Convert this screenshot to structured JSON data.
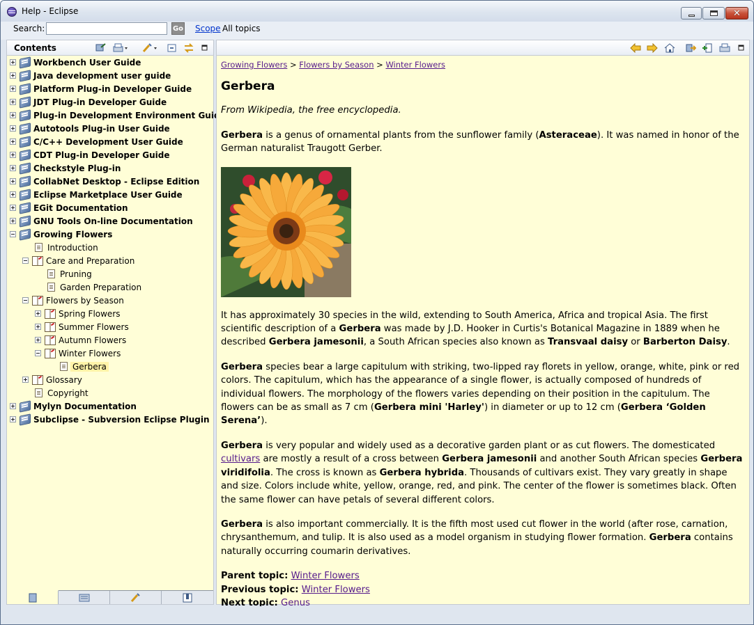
{
  "window": {
    "title": "Help - Eclipse"
  },
  "search": {
    "label": "Search:",
    "value": "",
    "go_label": "Go",
    "scope_link": "Scope",
    "scope_value": "All topics"
  },
  "contents": {
    "title": "Contents"
  },
  "tree": [
    {
      "label": "Workbench User Guide",
      "level": 0,
      "type": "book",
      "expander": "plus",
      "bold": true
    },
    {
      "label": "Java development user guide",
      "level": 0,
      "type": "book",
      "expander": "plus",
      "bold": true
    },
    {
      "label": "Platform Plug-in Developer Guide",
      "level": 0,
      "type": "book",
      "expander": "plus",
      "bold": true
    },
    {
      "label": "JDT Plug-in Developer Guide",
      "level": 0,
      "type": "book",
      "expander": "plus",
      "bold": true
    },
    {
      "label": "Plug-in Development Environment Guide",
      "level": 0,
      "type": "book",
      "expander": "plus",
      "bold": true
    },
    {
      "label": "Autotools Plug-in User Guide",
      "level": 0,
      "type": "book",
      "expander": "plus",
      "bold": true
    },
    {
      "label": "C/C++ Development User Guide",
      "level": 0,
      "type": "book",
      "expander": "plus",
      "bold": true
    },
    {
      "label": "CDT Plug-in Developer Guide",
      "level": 0,
      "type": "book",
      "expander": "plus",
      "bold": true
    },
    {
      "label": "Checkstyle Plug-in",
      "level": 0,
      "type": "book",
      "expander": "plus",
      "bold": true
    },
    {
      "label": "CollabNet Desktop - Eclipse Edition",
      "level": 0,
      "type": "book",
      "expander": "plus",
      "bold": true
    },
    {
      "label": "Eclipse Marketplace User Guide",
      "level": 0,
      "type": "book",
      "expander": "plus",
      "bold": true
    },
    {
      "label": "EGit Documentation",
      "level": 0,
      "type": "book",
      "expander": "plus",
      "bold": true
    },
    {
      "label": "GNU Tools On-line Documentation",
      "level": 0,
      "type": "book",
      "expander": "plus",
      "bold": true
    },
    {
      "label": "Growing Flowers",
      "level": 0,
      "type": "book",
      "expander": "minus",
      "bold": true
    },
    {
      "label": "Introduction",
      "level": 1,
      "type": "page",
      "expander": "none",
      "bold": false
    },
    {
      "label": "Care and Preparation",
      "level": 1,
      "type": "openbook",
      "expander": "minus",
      "bold": false
    },
    {
      "label": "Pruning",
      "level": 2,
      "type": "page",
      "expander": "none",
      "bold": false
    },
    {
      "label": "Garden Preparation",
      "level": 2,
      "type": "page",
      "expander": "none",
      "bold": false
    },
    {
      "label": "Flowers by Season",
      "level": 1,
      "type": "openbook",
      "expander": "minus",
      "bold": false
    },
    {
      "label": "Spring Flowers",
      "level": 2,
      "type": "openbook",
      "expander": "plus",
      "bold": false
    },
    {
      "label": "Summer Flowers",
      "level": 2,
      "type": "openbook",
      "expander": "plus",
      "bold": false
    },
    {
      "label": "Autumn Flowers",
      "level": 2,
      "type": "openbook",
      "expander": "plus",
      "bold": false
    },
    {
      "label": "Winter Flowers",
      "level": 2,
      "type": "openbook",
      "expander": "minus",
      "bold": false
    },
    {
      "label": "Gerbera",
      "level": 3,
      "type": "page",
      "expander": "none",
      "bold": false,
      "selected": true
    },
    {
      "label": "Glossary",
      "level": 1,
      "type": "openbook",
      "expander": "plus",
      "bold": false
    },
    {
      "label": "Copyright",
      "level": 1,
      "type": "page",
      "expander": "none",
      "bold": false
    },
    {
      "label": "Mylyn Documentation",
      "level": 0,
      "type": "book",
      "expander": "plus",
      "bold": true
    },
    {
      "label": "Subclipse - Subversion Eclipse Plugin",
      "level": 0,
      "type": "book",
      "expander": "plus",
      "bold": true
    }
  ],
  "breadcrumb": [
    "Growing Flowers",
    "Flowers by Season",
    "Winter Flowers"
  ],
  "breadcrumb_sep": ">",
  "article": {
    "title": "Gerbera",
    "source": "From Wikipedia, the free encyclopedia.",
    "p1": [
      {
        "t": "Gerbera",
        "b": true
      },
      {
        "t": " is a genus of ornamental plants from the sunflower family ("
      },
      {
        "t": "Asteraceae",
        "b": true
      },
      {
        "t": "). It was named in honor of the German naturalist Traugott Gerber."
      }
    ],
    "p2": [
      {
        "t": "It has approximately 30 species in the wild, extending to South America, Africa and tropical Asia. The first scientific description of a "
      },
      {
        "t": "Gerbera",
        "b": true
      },
      {
        "t": " was made by J.D. Hooker in Curtis's Botanical Magazine in 1889 when he described "
      },
      {
        "t": "Gerbera jamesonii",
        "b": true
      },
      {
        "t": ", a South African species also known as "
      },
      {
        "t": "Transvaal daisy",
        "b": true
      },
      {
        "t": " or "
      },
      {
        "t": "Barberton Daisy",
        "b": true
      },
      {
        "t": "."
      }
    ],
    "p3": [
      {
        "t": "Gerbera",
        "b": true
      },
      {
        "t": " species bear a large capitulum with striking, two-lipped ray florets in yellow, orange, white, pink or red colors. The capitulum, which has the appearance of a single flower, is actually composed of hundreds of individual flowers. The morphology of the flowers varies depending on their position in the capitulum. The flowers can be as small as 7 cm ("
      },
      {
        "t": "Gerbera mini 'Harley'",
        "b": true
      },
      {
        "t": ") in diameter or up to 12 cm ("
      },
      {
        "t": "Gerbera ‘Golden Serena’",
        "b": true
      },
      {
        "t": ")."
      }
    ],
    "p4": [
      {
        "t": "Gerbera",
        "b": true
      },
      {
        "t": " is very popular and widely used as a decorative garden plant or as cut flowers. The domesticated "
      },
      {
        "t": "cultivars",
        "link": true
      },
      {
        "t": " are mostly a result of a cross between "
      },
      {
        "t": "Gerbera jamesonii",
        "b": true
      },
      {
        "t": " and another South African species "
      },
      {
        "t": "Gerbera viridifolia",
        "b": true
      },
      {
        "t": ". The cross is known as "
      },
      {
        "t": "Gerbera hybrida",
        "b": true
      },
      {
        "t": ". Thousands of cultivars exist. They vary greatly in shape and size. Colors include white, yellow, orange, red, and pink. The center of the flower is sometimes black. Often the same flower can have petals of several different colors."
      }
    ],
    "p5": [
      {
        "t": "Gerbera",
        "b": true
      },
      {
        "t": " is also important commercially. It is the fifth most used cut flower in the world (after rose, carnation, chrysanthemum, and tulip. It is also used as a model organism in studying flower formation. "
      },
      {
        "t": "Gerbera",
        "b": true
      },
      {
        "t": " contains naturally occurring coumarin derivatives."
      }
    ],
    "nav": [
      {
        "label": "Parent topic:",
        "link": "Winter Flowers"
      },
      {
        "label": "Previous topic:",
        "link": "Winter Flowers"
      },
      {
        "label": "Next topic:",
        "link": "Genus"
      }
    ]
  },
  "colors": {
    "pane_bg": "#fffed7",
    "link": "#551a8b",
    "selection": "#fff3a8",
    "scope_link": "#0033cc"
  }
}
